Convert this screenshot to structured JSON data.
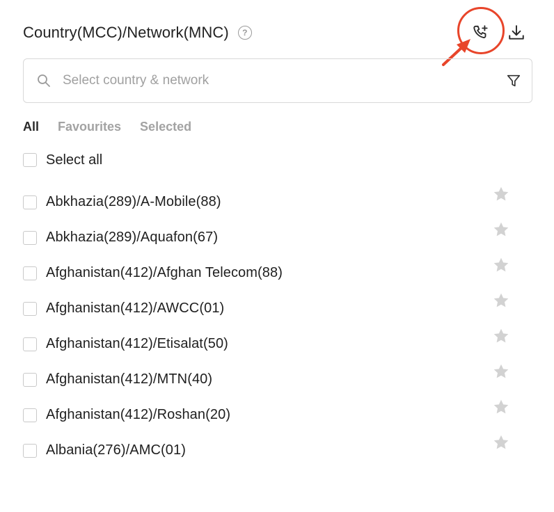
{
  "header": {
    "title": "Country(MCC)/Network(MNC)",
    "help_glyph": "?"
  },
  "actions": {
    "add_call_icon": "phone-plus-icon",
    "download_icon": "download-icon"
  },
  "annotation": {
    "color": "#e8452a"
  },
  "search": {
    "placeholder": "Select country & network",
    "value": ""
  },
  "tabs": [
    {
      "label": "All",
      "active": true
    },
    {
      "label": "Favourites",
      "active": false
    },
    {
      "label": "Selected",
      "active": false
    }
  ],
  "select_all": {
    "label": "Select all",
    "checked": false
  },
  "items": [
    {
      "label": "Abkhazia(289)/A-Mobile(88)",
      "checked": false,
      "favourite": false
    },
    {
      "label": "Abkhazia(289)/Aquafon(67)",
      "checked": false,
      "favourite": false
    },
    {
      "label": "Afghanistan(412)/Afghan Telecom(88)",
      "checked": false,
      "favourite": false
    },
    {
      "label": "Afghanistan(412)/AWCC(01)",
      "checked": false,
      "favourite": false
    },
    {
      "label": "Afghanistan(412)/Etisalat(50)",
      "checked": false,
      "favourite": false
    },
    {
      "label": "Afghanistan(412)/MTN(40)",
      "checked": false,
      "favourite": false
    },
    {
      "label": "Afghanistan(412)/Roshan(20)",
      "checked": false,
      "favourite": false
    },
    {
      "label": "Albania(276)/AMC(01)",
      "checked": false,
      "favourite": false
    }
  ]
}
